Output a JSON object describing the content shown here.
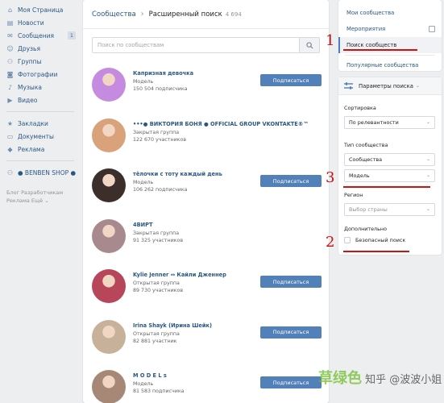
{
  "leftnav": {
    "items": [
      {
        "label": "Моя Страница",
        "icon": "home-icon"
      },
      {
        "label": "Новости",
        "icon": "news-icon"
      },
      {
        "label": "Сообщения",
        "icon": "message-icon",
        "badge": "1"
      },
      {
        "label": "Друзья",
        "icon": "user-icon"
      },
      {
        "label": "Группы",
        "icon": "group-icon"
      },
      {
        "label": "Фотографии",
        "icon": "camera-icon"
      },
      {
        "label": "Музыка",
        "icon": "music-icon"
      },
      {
        "label": "Видео",
        "icon": "video-icon"
      }
    ],
    "items2": [
      {
        "label": "Закладки",
        "icon": "star-icon"
      },
      {
        "label": "Документы",
        "icon": "document-icon"
      },
      {
        "label": "Реклама",
        "icon": "megaphone-icon"
      }
    ],
    "shop": {
      "label": "● BENBEN SHOP ●",
      "icon": "group-icon"
    },
    "footer1": "Блог   Разработчикам",
    "footer2": "Реклама   Ещё ⌄"
  },
  "header": {
    "crumb": "Сообщества",
    "arrow": "›",
    "current": "Расширенный поиск",
    "count": "4 694"
  },
  "search": {
    "placeholder": "Поиск по сообществам"
  },
  "results": [
    {
      "name": "Капризная девочка",
      "type": "Модель",
      "members": "150 504 подписчика",
      "button": "Подписаться",
      "avatar_color": "#c58be0"
    },
    {
      "name": "•••● ВИКТОРИЯ БОНЯ ● OFFICIAL GROUP VKONTAKTE®™",
      "type": "Закрытая группа",
      "members": "122 670 участников",
      "button": "",
      "avatar_color": "#d9a27a"
    },
    {
      "name": "тёлочки с тоту каждый день",
      "type": "Модель",
      "members": "106 262 подписчика",
      "button": "Подписаться",
      "avatar_color": "#3c2e2b"
    },
    {
      "name": "4ВИРТ",
      "type": "Закрытая группа",
      "members": "91 325 участников",
      "button": "",
      "avatar_color": "#a88a8e"
    },
    {
      "name": "Kylie Jenner ↔ Кайли Дженнер",
      "type": "Открытая группа",
      "members": "89 730 участников",
      "button": "Подписаться",
      "avatar_color": "#b8465a"
    },
    {
      "name": "Irina Shayk (Ирина Шейк)",
      "type": "Открытая группа",
      "members": "82 881 участник",
      "button": "Подписаться",
      "avatar_color": "#c8b19a"
    },
    {
      "name": "M O D E L s",
      "type": "Модель",
      "members": "81 583 подписчика",
      "button": "Подписаться",
      "avatar_color": "#a78877"
    }
  ],
  "rightmenu": {
    "items": [
      "Мои сообщества",
      "Мероприятия",
      "Поиск сообществ",
      "Популярные сообщества"
    ],
    "active_index": 2
  },
  "params": {
    "title": "Параметры поиска",
    "sort_label": "Сортировка",
    "sort_value": "По релевантности",
    "type_label": "Тип сообщества",
    "type_value": "Сообщества",
    "subtype_value": "Модель",
    "region_label": "Регион",
    "region_placeholder": "Выбор страны",
    "extra_label": "Дополнительно",
    "safe_search": "Безопасный поиск"
  },
  "annotations": {
    "n1": "1",
    "n2": "2",
    "n3": "3"
  },
  "watermark": {
    "text": "知乎 @波波小姐",
    "logo": "草绿色"
  },
  "colors": {
    "accent": "#5181b8",
    "link": "#2a5885",
    "annotation": "#d21010"
  }
}
